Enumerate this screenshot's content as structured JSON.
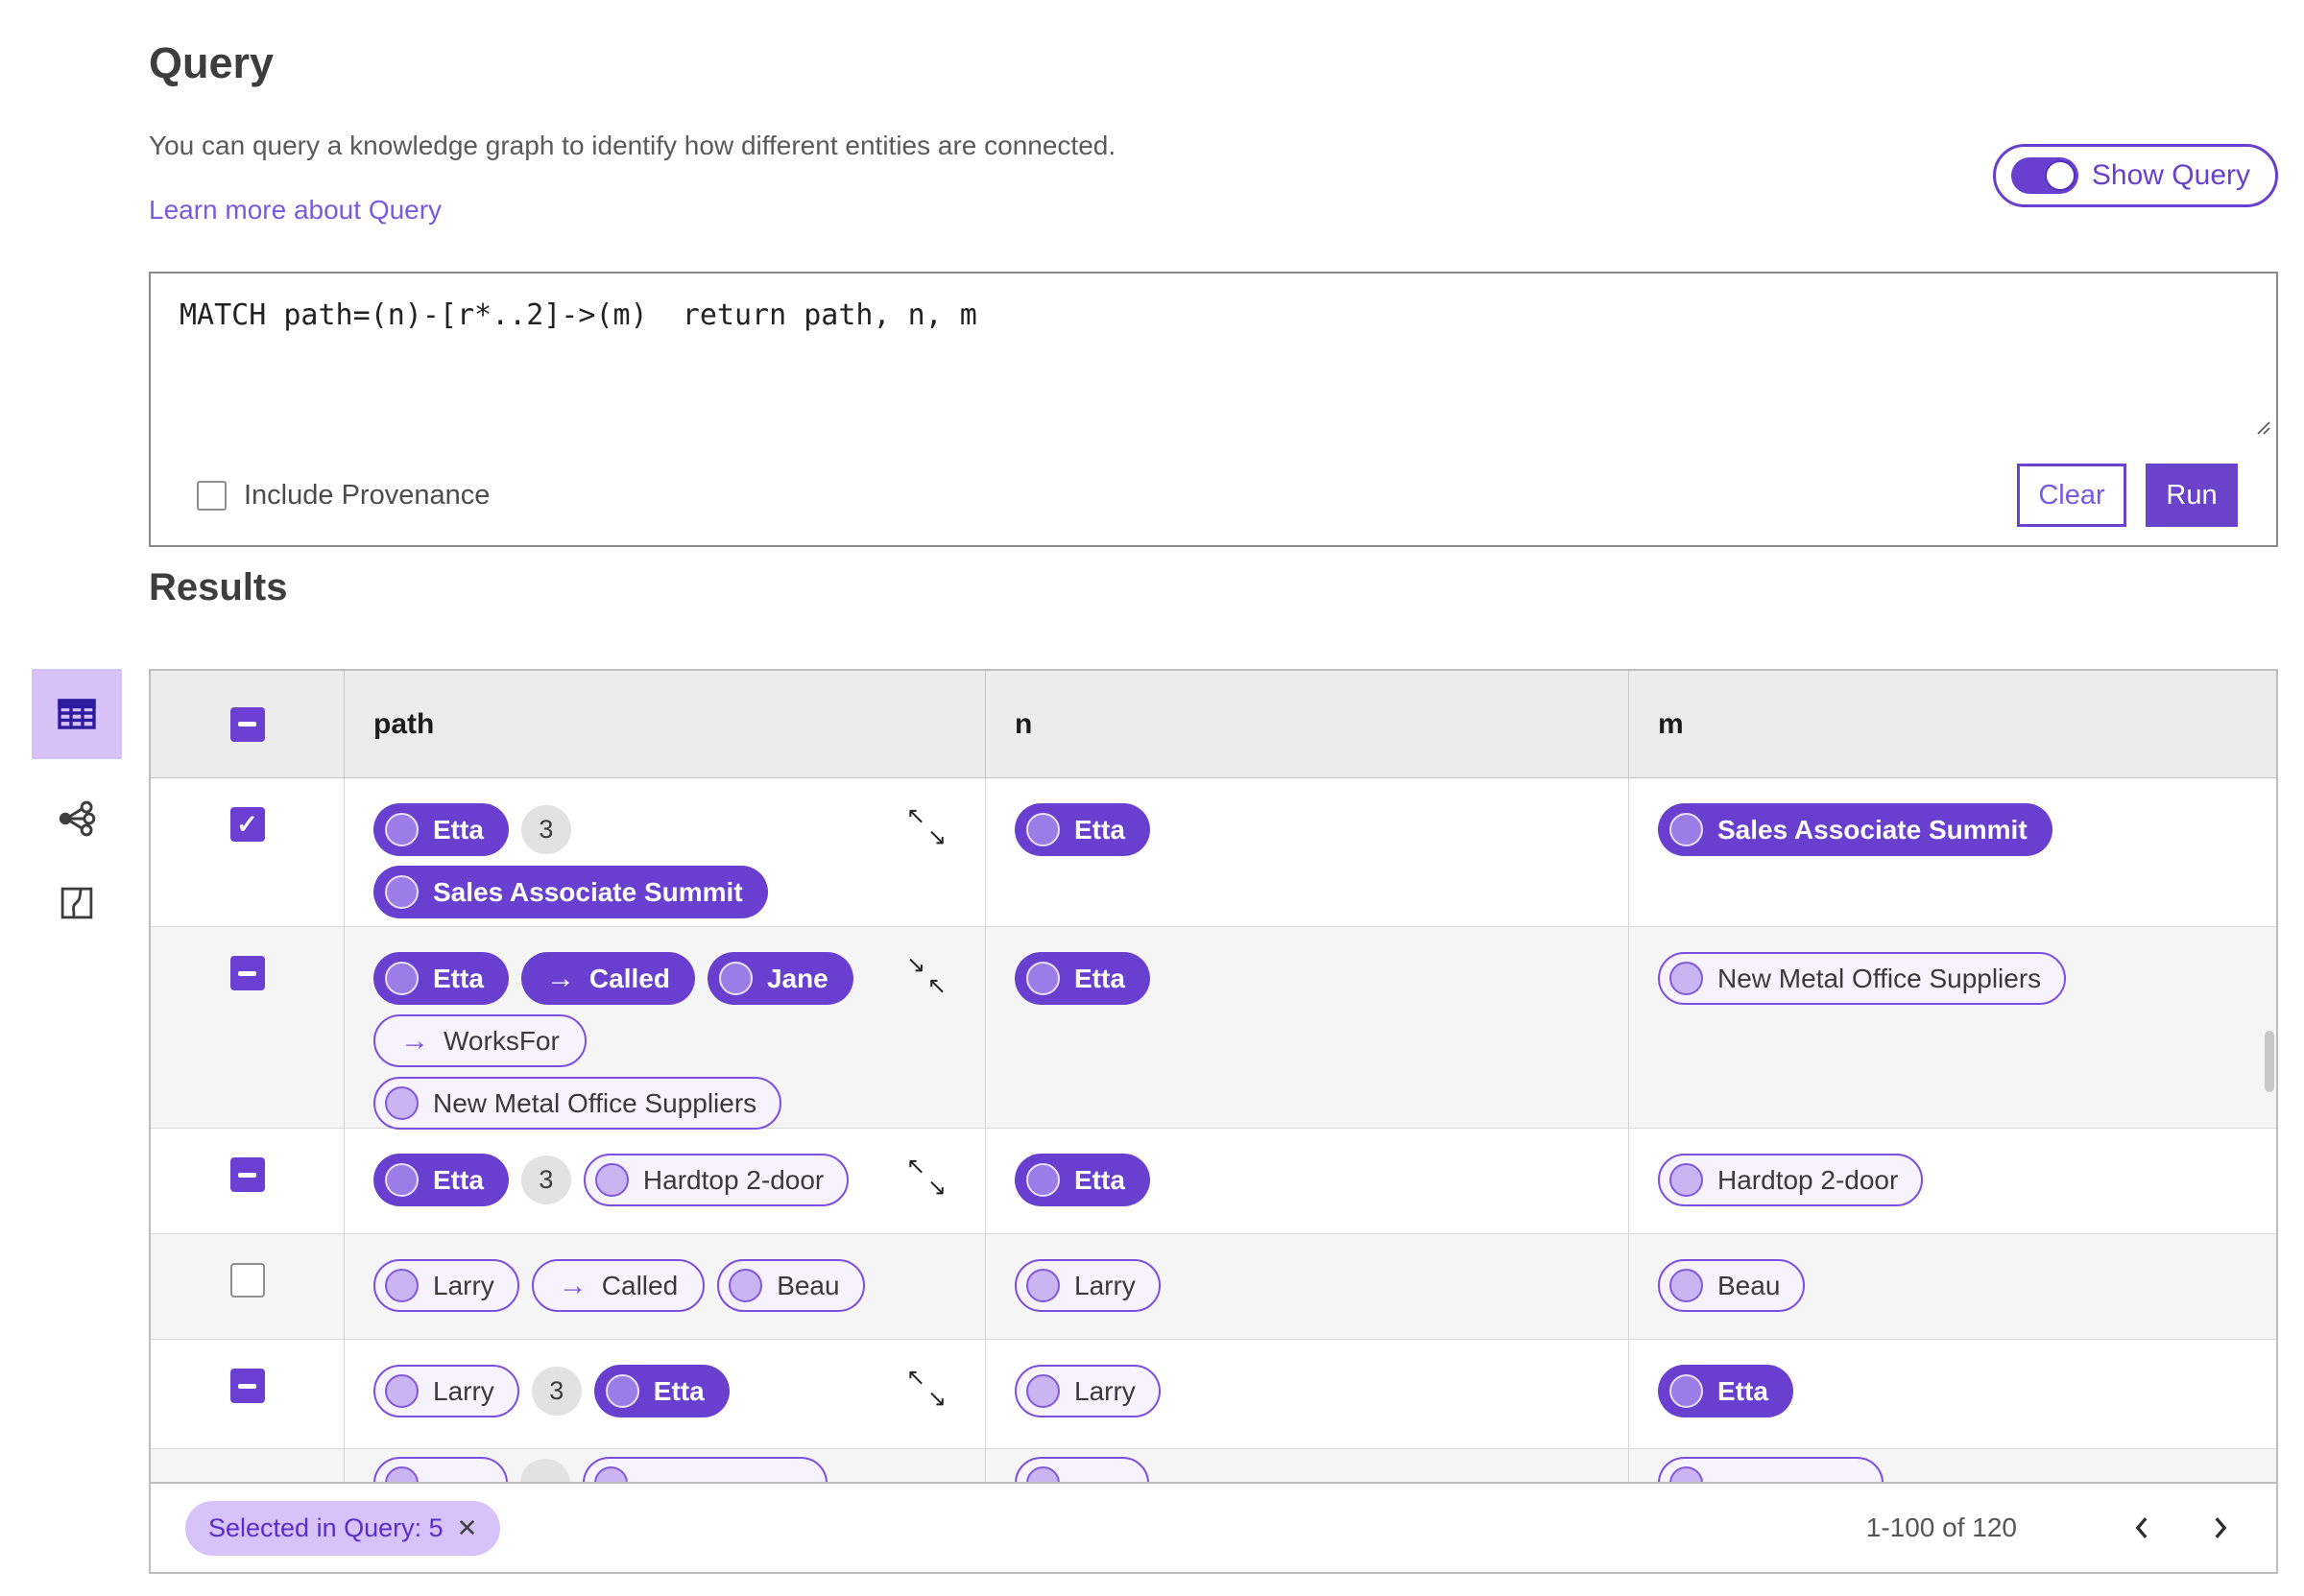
{
  "header": {
    "title": "Query",
    "description": "You can query a knowledge graph to identify how different entities are connected.",
    "learn_more": "Learn more about Query",
    "show_query_label": "Show Query"
  },
  "editor": {
    "query_text": "MATCH path=(n)-[r*..2]->(m)  return path, n, m",
    "include_provenance_label": "Include Provenance",
    "include_provenance_checked": false,
    "clear_label": "Clear",
    "run_label": "Run"
  },
  "sidebar": {
    "views": [
      {
        "name": "table-view",
        "active": true
      },
      {
        "name": "graph-view",
        "active": false
      },
      {
        "name": "map-view",
        "active": false
      }
    ]
  },
  "results": {
    "title": "Results",
    "columns": [
      "path",
      "n",
      "m"
    ],
    "header_checkbox_state": "indeterminate",
    "rows": [
      {
        "checkbox": "checked",
        "arrows": "expand",
        "path": {
          "l1": [
            {
              "label": "Etta",
              "style": "filled-node"
            },
            {
              "label": "3",
              "style": "badge"
            }
          ],
          "l2": [
            {
              "label": "Sales Associate Summit",
              "style": "filled-node"
            }
          ]
        },
        "n": {
          "label": "Etta",
          "style": "filled-node"
        },
        "m": {
          "label": "Sales Associate Summit",
          "style": "filled-node"
        }
      },
      {
        "checkbox": "indeterminate",
        "arrows": "collapse",
        "path": {
          "l1": [
            {
              "label": "Etta",
              "style": "filled-node"
            },
            {
              "label": "Called",
              "style": "filled-edge"
            },
            {
              "label": "Jane",
              "style": "filled-node"
            }
          ],
          "l2": [
            {
              "label": "WorksFor",
              "style": "outline-edge"
            }
          ],
          "l3": [
            {
              "label": "New Metal Office Suppliers",
              "style": "outline-node"
            }
          ]
        },
        "n": {
          "label": "Etta",
          "style": "filled-node"
        },
        "m": {
          "label": "New Metal Office Suppliers",
          "style": "outline-node"
        }
      },
      {
        "checkbox": "indeterminate",
        "arrows": "expand",
        "path": {
          "l1": [
            {
              "label": "Etta",
              "style": "filled-node"
            },
            {
              "label": "3",
              "style": "badge"
            },
            {
              "label": "Hardtop 2-door",
              "style": "outline-node"
            }
          ]
        },
        "n": {
          "label": "Etta",
          "style": "filled-node"
        },
        "m": {
          "label": "Hardtop 2-door",
          "style": "outline-node"
        }
      },
      {
        "checkbox": "unchecked",
        "arrows": "none",
        "path": {
          "l1": [
            {
              "label": "Larry",
              "style": "outline-node"
            },
            {
              "label": "Called",
              "style": "outline-edge"
            },
            {
              "label": "Beau",
              "style": "outline-node"
            }
          ]
        },
        "n": {
          "label": "Larry",
          "style": "outline-node"
        },
        "m": {
          "label": "Beau",
          "style": "outline-node"
        }
      },
      {
        "checkbox": "indeterminate",
        "arrows": "expand",
        "path": {
          "l1": [
            {
              "label": "Larry",
              "style": "outline-node"
            },
            {
              "label": "3",
              "style": "badge"
            },
            {
              "label": "Etta",
              "style": "filled-node"
            }
          ]
        },
        "n": {
          "label": "Larry",
          "style": "outline-node"
        },
        "m": {
          "label": "Etta",
          "style": "filled-node"
        }
      },
      {
        "checkbox": "hidden",
        "arrows": "none",
        "clipped": true,
        "path": {
          "l1": [
            {
              "label": "",
              "style": "outline-node"
            },
            {
              "label": "",
              "style": "badge"
            },
            {
              "label": "",
              "style": "outline-node"
            }
          ]
        },
        "n": {
          "label": "",
          "style": "outline-node"
        },
        "m": {
          "label": "",
          "style": "outline-node"
        }
      }
    ],
    "footer": {
      "filter_chip": "Selected in Query: 5",
      "pagination": "1-100 of 120"
    }
  },
  "icons": {
    "edge_arrow": "→",
    "arrow_nw": "↖",
    "arrow_se": "↘",
    "check": "✓",
    "close": "✕"
  },
  "colors": {
    "primary_purple": "#693fd0",
    "pill_outline_bg": "#f6f3fe",
    "pill_outline_border": "#7b4fe0",
    "badge_gray": "#e2e2e2",
    "selected_tile": "#d6c2f7",
    "chip_bg": "#d8c2fa",
    "chip_text": "#5a2dc8",
    "table_header_bg": "#ececec",
    "row_shade": "#f5f5f5",
    "link": "#7a5ae0"
  }
}
